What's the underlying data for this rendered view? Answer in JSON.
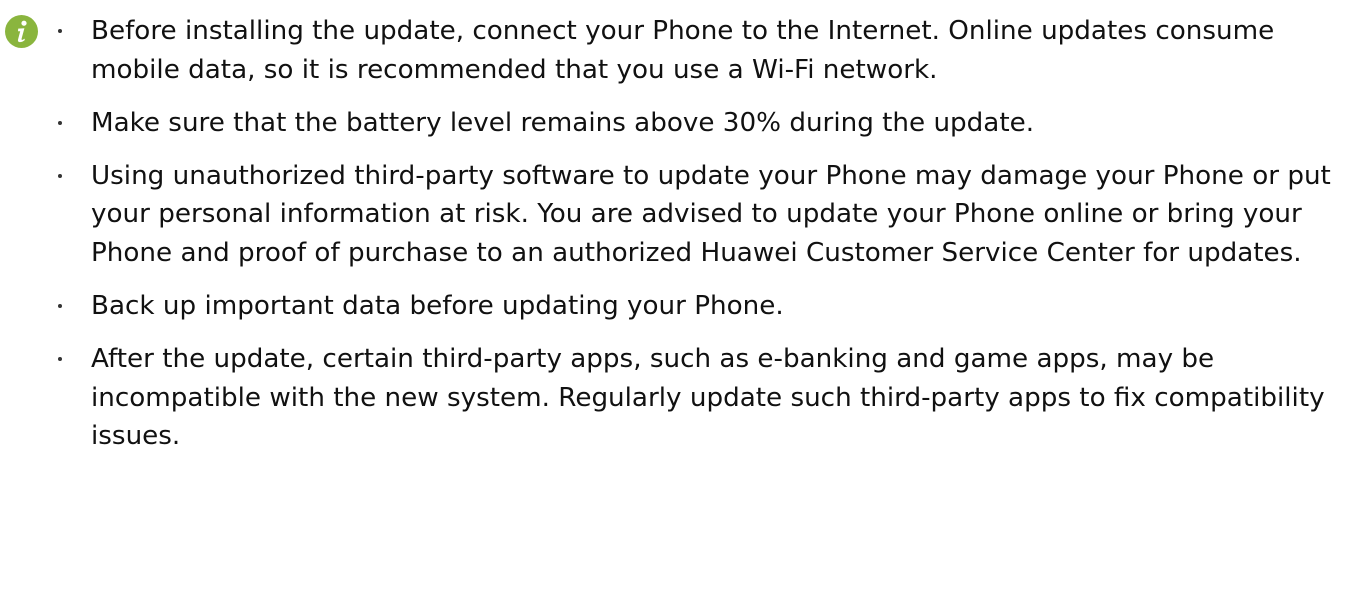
{
  "note": {
    "icon": "info-icon",
    "icon_color": "#8ab53e",
    "items": [
      "Before installing the update, connect your Phone to the Internet. Online updates consume mobile data, so it is recommended that you use a Wi-Fi network.",
      "Make sure that the battery level remains above 30% during the update.",
      "Using unauthorized third-party software to update your Phone may damage your Phone or put your personal information at risk. You are advised to update your Phone online or bring your Phone and proof of purchase to an authorized Huawei Customer Service Center for updates.",
      "Back up important data before updating your Phone.",
      "After the update, certain third-party apps, such as e-banking and game apps, may be incompatible with the new system. Regularly update such third-party apps to fix compatibility issues."
    ]
  }
}
